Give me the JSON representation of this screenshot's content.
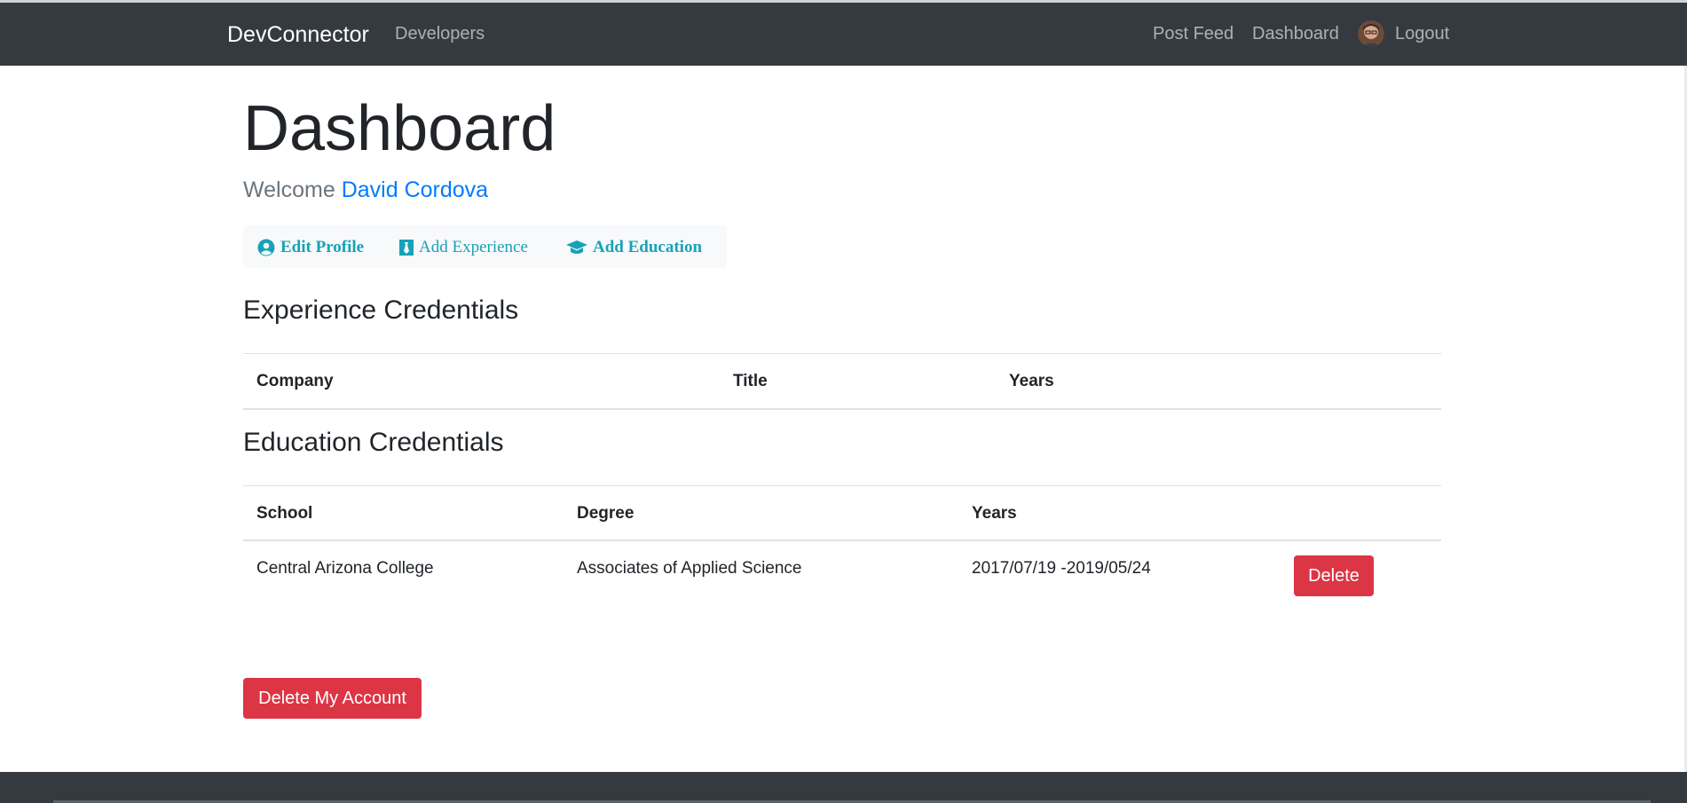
{
  "navbar": {
    "brand": "DevConnector",
    "developers": "Developers",
    "post_feed": "Post Feed",
    "dashboard": "Dashboard",
    "logout": "Logout"
  },
  "page": {
    "title": "Dashboard",
    "welcome_prefix": "Welcome",
    "user_name": "David Cordova"
  },
  "actions": {
    "edit_profile": "Edit Profile",
    "add_experience": "Add Experience",
    "add_education": "Add Education"
  },
  "experience": {
    "title": "Experience Credentials",
    "headers": [
      "Company",
      "Title",
      "Years"
    ]
  },
  "education": {
    "title": "Education Credentials",
    "headers": [
      "School",
      "Degree",
      "Years"
    ],
    "rows": [
      {
        "school": "Central Arizona College",
        "degree": "Associates of Applied Science",
        "years": "2017/07/19 -2019/05/24",
        "delete_label": "Delete"
      }
    ]
  },
  "delete_account_label": "Delete My Account",
  "colors": {
    "navbar": "#343a40",
    "primary": "#007bff",
    "info": "#17a2b8",
    "danger": "#dc3545"
  }
}
